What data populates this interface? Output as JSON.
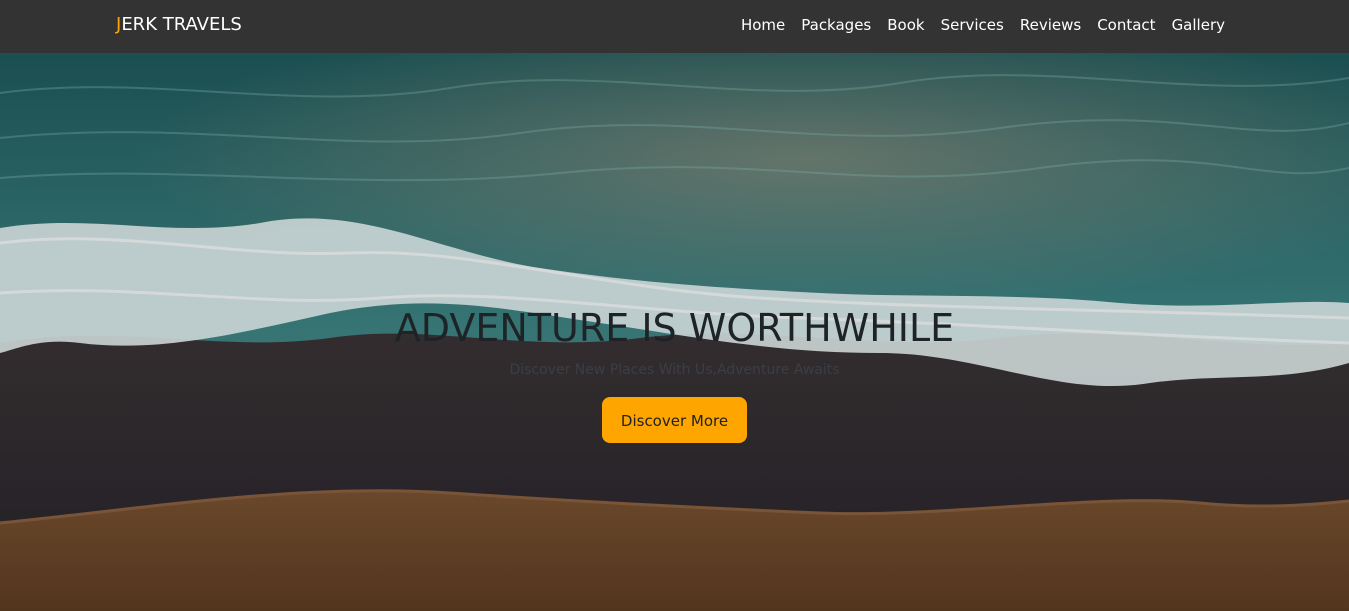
{
  "brand": {
    "first_letter": "J",
    "rest": "ERK TRAVELS",
    "accent_color": "#ffa500"
  },
  "nav": {
    "items": [
      "Home",
      "Packages",
      "Book",
      "Services",
      "Reviews",
      "Contact",
      "Gallery"
    ]
  },
  "hero": {
    "title": "ADVENTURE IS WORTHWHILE",
    "subtitle": "Discover New Places With Us,Adventure Awaits",
    "button_label": "Discover More",
    "button_color": "#ffa500"
  },
  "colors": {
    "navbar_bg": "#333333",
    "sea": "#2d6b6b",
    "foam": "#e6f2f3",
    "wet_sand": "#2f2b2c",
    "sand": "#6f4a2c"
  }
}
